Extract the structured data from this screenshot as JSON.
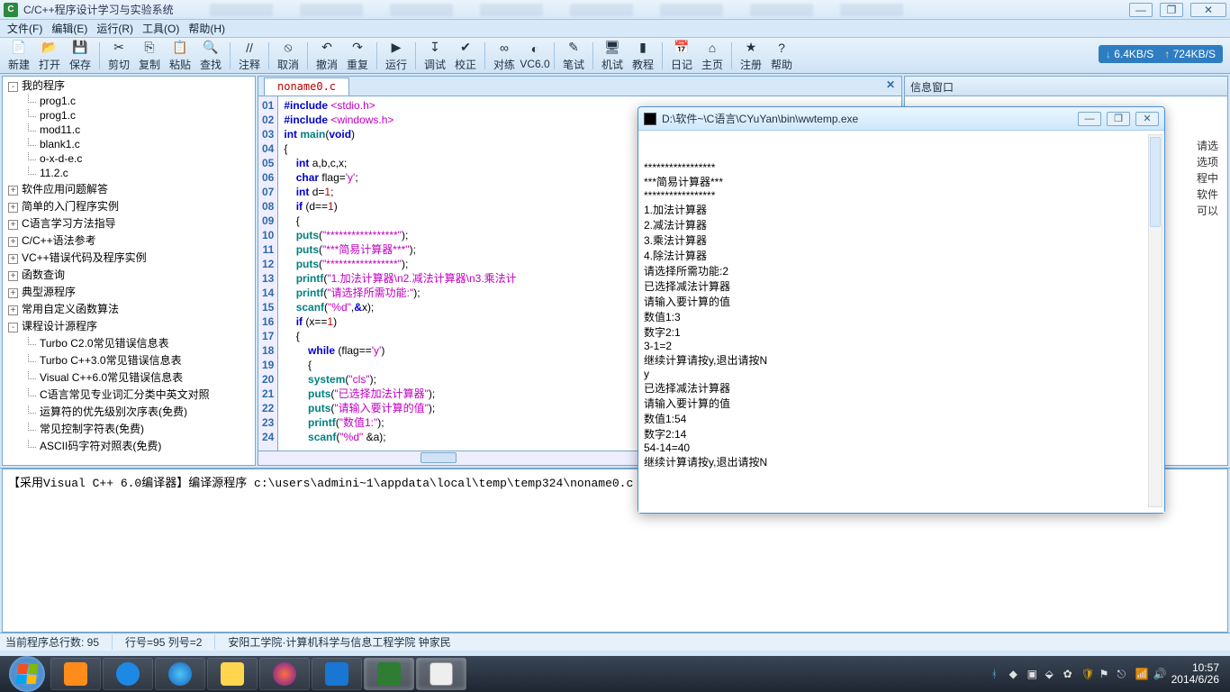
{
  "app": {
    "title": "C/C++程序设计学习与实验系统",
    "icon_letter": "C"
  },
  "window_buttons": {
    "min": "—",
    "max": "❐",
    "close": "✕"
  },
  "menu": [
    "文件(F)",
    "编辑(E)",
    "运行(R)",
    "工具(O)",
    "帮助(H)"
  ],
  "toolbar": [
    {
      "label": "新建",
      "icon": "📄",
      "name": "new"
    },
    {
      "label": "打开",
      "icon": "📂",
      "name": "open"
    },
    {
      "label": "保存",
      "icon": "💾",
      "name": "save"
    },
    {
      "sep": true
    },
    {
      "label": "剪切",
      "icon": "✂",
      "name": "cut"
    },
    {
      "label": "复制",
      "icon": "⎘",
      "name": "copy"
    },
    {
      "label": "粘贴",
      "icon": "📋",
      "name": "paste"
    },
    {
      "label": "查找",
      "icon": "🔍",
      "name": "find"
    },
    {
      "sep": true
    },
    {
      "label": "注释",
      "icon": "//",
      "name": "comment"
    },
    {
      "sep": true
    },
    {
      "label": "取消",
      "icon": "⦸",
      "name": "cancel"
    },
    {
      "sep": true
    },
    {
      "label": "撤消",
      "icon": "↶",
      "name": "undo"
    },
    {
      "label": "重复",
      "icon": "↷",
      "name": "redo"
    },
    {
      "sep": true
    },
    {
      "label": "运行",
      "icon": "▶",
      "name": "run"
    },
    {
      "sep": true
    },
    {
      "label": "调试",
      "icon": "↧",
      "name": "debug"
    },
    {
      "label": "校正",
      "icon": "✔",
      "name": "check"
    },
    {
      "sep": true
    },
    {
      "label": "对练",
      "icon": "∞",
      "name": "practice"
    },
    {
      "label": "VC6.0",
      "icon": "◐",
      "name": "vc6"
    },
    {
      "sep": true
    },
    {
      "label": "笔试",
      "icon": "✎",
      "name": "written"
    },
    {
      "sep": true
    },
    {
      "label": "机试",
      "icon": "🖥",
      "name": "machine"
    },
    {
      "label": "教程",
      "icon": "▮",
      "name": "tutorial"
    },
    {
      "sep": true
    },
    {
      "label": "日记",
      "icon": "📅",
      "name": "diary"
    },
    {
      "label": "主页",
      "icon": "⌂",
      "name": "home"
    },
    {
      "sep": true
    },
    {
      "label": "注册",
      "icon": "★",
      "name": "register"
    },
    {
      "label": "帮助",
      "icon": "?",
      "name": "help"
    }
  ],
  "netspeed": {
    "down": "6.4KB/S",
    "up": "724KB/S"
  },
  "tree": {
    "root": "我的程序",
    "children": [
      "prog1.c",
      "prog1.c",
      "mod11.c",
      "blank1.c",
      "o-x-d-e.c",
      "11.2.c"
    ],
    "siblings": [
      "软件应用问题解答",
      "简单的入门程序实例",
      "C语言学习方法指导",
      "C/C++语法参考",
      "VC++错误代码及程序实例",
      "函数查询",
      "典型源程序",
      "常用自定义函数算法",
      "课程设计源程序"
    ],
    "sib_children": [
      "Turbo C2.0常见错误信息表",
      "Turbo C++3.0常见错误信息表",
      "Visual C++6.0常见错误信息表",
      "C语言常见专业词汇分类中英文对照",
      "运算符的优先级别次序表(免费)",
      "常见控制字符表(免费)",
      "ASCII码字符对照表(免费)"
    ]
  },
  "editor": {
    "tab": "noname0.c",
    "lines": [
      [
        {
          "t": "#include ",
          "c": "kw"
        },
        {
          "t": "<stdio.h>",
          "c": "inc"
        }
      ],
      [
        {
          "t": "#include ",
          "c": "kw"
        },
        {
          "t": "<windows.h>",
          "c": "inc"
        }
      ],
      [
        {
          "t": "int ",
          "c": "kw"
        },
        {
          "t": "main",
          "c": "fn"
        },
        {
          "t": "(",
          "c": "pun"
        },
        {
          "t": "void",
          "c": "kw"
        },
        {
          "t": ")",
          "c": "pun"
        }
      ],
      [
        {
          "t": "{",
          "c": "pun"
        }
      ],
      [
        {
          "t": "    int ",
          "c": "kw"
        },
        {
          "t": "a,b,c,x;",
          "c": "pun"
        }
      ],
      [
        {
          "t": "    char ",
          "c": "kw"
        },
        {
          "t": "flag=",
          "c": "pun"
        },
        {
          "t": "'y'",
          "c": "str"
        },
        {
          "t": ";",
          "c": "pun"
        }
      ],
      [
        {
          "t": "    int ",
          "c": "kw"
        },
        {
          "t": "d=",
          "c": "pun"
        },
        {
          "t": "1",
          "c": "num"
        },
        {
          "t": ";",
          "c": "pun"
        }
      ],
      [
        {
          "t": "    if ",
          "c": "kw"
        },
        {
          "t": "(d==",
          "c": "pun"
        },
        {
          "t": "1",
          "c": "num"
        },
        {
          "t": ")",
          "c": "pun"
        }
      ],
      [
        {
          "t": "    {",
          "c": "pun"
        }
      ],
      [
        {
          "t": "    puts",
          "c": "fn"
        },
        {
          "t": "(",
          "c": "pun"
        },
        {
          "t": "\"*****************\"",
          "c": "str"
        },
        {
          "t": ");",
          "c": "pun"
        }
      ],
      [
        {
          "t": "    puts",
          "c": "fn"
        },
        {
          "t": "(",
          "c": "pun"
        },
        {
          "t": "\"***简易计算器***\"",
          "c": "str"
        },
        {
          "t": ");",
          "c": "pun"
        }
      ],
      [
        {
          "t": "    puts",
          "c": "fn"
        },
        {
          "t": "(",
          "c": "pun"
        },
        {
          "t": "\"*****************\"",
          "c": "str"
        },
        {
          "t": ");",
          "c": "pun"
        }
      ],
      [
        {
          "t": "    printf",
          "c": "fn"
        },
        {
          "t": "(",
          "c": "pun"
        },
        {
          "t": "\"1.加法计算器\\n2.减法计算器\\n3.乘法计",
          "c": "str"
        }
      ],
      [
        {
          "t": "    printf",
          "c": "fn"
        },
        {
          "t": "(",
          "c": "pun"
        },
        {
          "t": "\"请选择所需功能:\"",
          "c": "str"
        },
        {
          "t": ");",
          "c": "pun"
        }
      ],
      [
        {
          "t": "    scanf",
          "c": "fn"
        },
        {
          "t": "(",
          "c": "pun"
        },
        {
          "t": "\"%d\"",
          "c": "str"
        },
        {
          "t": ",",
          "c": "pun"
        },
        {
          "t": "&",
          "c": "kw"
        },
        {
          "t": "x);",
          "c": "pun"
        }
      ],
      [
        {
          "t": "    if ",
          "c": "kw"
        },
        {
          "t": "(x==",
          "c": "pun"
        },
        {
          "t": "1",
          "c": "num"
        },
        {
          "t": ")",
          "c": "pun"
        }
      ],
      [
        {
          "t": "    {",
          "c": "pun"
        }
      ],
      [
        {
          "t": "        while ",
          "c": "kw"
        },
        {
          "t": "(flag==",
          "c": "pun"
        },
        {
          "t": "'y'",
          "c": "str"
        },
        {
          "t": ")",
          "c": "pun"
        }
      ],
      [
        {
          "t": "        {",
          "c": "pun"
        }
      ],
      [
        {
          "t": "        system",
          "c": "fn"
        },
        {
          "t": "(",
          "c": "pun"
        },
        {
          "t": "\"cls\"",
          "c": "str"
        },
        {
          "t": ");",
          "c": "pun"
        }
      ],
      [
        {
          "t": "        puts",
          "c": "fn"
        },
        {
          "t": "(",
          "c": "pun"
        },
        {
          "t": "\"已选择加法计算器\"",
          "c": "str"
        },
        {
          "t": ");",
          "c": "pun"
        }
      ],
      [
        {
          "t": "        puts",
          "c": "fn"
        },
        {
          "t": "(",
          "c": "pun"
        },
        {
          "t": "\"请输入要计算的值\"",
          "c": "str"
        },
        {
          "t": ");",
          "c": "pun"
        }
      ],
      [
        {
          "t": "        printf",
          "c": "fn"
        },
        {
          "t": "(",
          "c": "pun"
        },
        {
          "t": "\"数值1:\"",
          "c": "str"
        },
        {
          "t": ");",
          "c": "pun"
        }
      ],
      [
        {
          "t": "        scanf",
          "c": "fn"
        },
        {
          "t": "(",
          "c": "pun"
        },
        {
          "t": "\"%d\"",
          "c": "str"
        },
        {
          "t": " &a);",
          "c": "pun"
        }
      ]
    ]
  },
  "info_panel": {
    "title": "信息窗口",
    "hints": [
      "请选",
      "选项",
      "",
      "程中",
      "",
      "软件",
      "可以"
    ]
  },
  "console": {
    "title": "D:\\软件~\\C语言\\CYuYan\\bin\\wwtemp.exe",
    "lines": [
      "*****************",
      "***简易计算器***",
      "*****************",
      "1.加法计算器",
      "2.减法计算器",
      "3.乘法计算器",
      "4.除法计算器",
      "",
      "请选择所需功能:2",
      "已选择减法计算器",
      "请输入要计算的值",
      "数值1:3",
      "数字2:1",
      "3-1=2",
      "继续计算请按y,退出请按N",
      "y",
      "已选择减法计算器",
      "请输入要计算的值",
      "数值1:54",
      "数字2:14",
      "54-14=40",
      "继续计算请按y,退出请按N"
    ]
  },
  "output": "【采用Visual C++ 6.0编译器】编译源程序 c:\\users\\admini~1\\appdata\\local\\temp\\temp324\\noname0.c",
  "status": {
    "left": "当前程序总行数:  95",
    "mid": "行号=95 列号=2",
    "right": "安阳工学院·计算机科学与信息工程学院   钟家民"
  },
  "tray": {
    "time": "10:57",
    "date": "2014/6/26"
  }
}
